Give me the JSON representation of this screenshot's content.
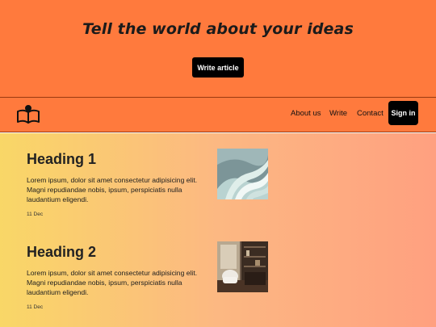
{
  "hero": {
    "title": "Tell the world about your ideas",
    "write_button": "Write article"
  },
  "nav": {
    "logo_icon": "open-book-icon",
    "links": [
      "About us",
      "Write",
      "Contact"
    ],
    "signin_button": "Sign in"
  },
  "articles": [
    {
      "heading": "Heading 1",
      "body": "Lorem ipsum, dolor sit amet consectetur adipisicing elit. Magni repudiandae nobis, ipsum, perspiciatis nulla laudantium eligendi.",
      "date": "11 Dec",
      "image": "abstract-waves-image"
    },
    {
      "heading": "Heading 2",
      "body": "Lorem ipsum, dolor sit amet consectetur adipisicing elit. Magni repudiandae nobis, ipsum, perspiciatis nulla laudantium eligendi.",
      "date": "11 Dec",
      "image": "interior-room-image"
    }
  ],
  "colors": {
    "header_bg": "#ff7a3d",
    "button_bg": "#000000",
    "gradient_start": "#f9d767",
    "gradient_end": "#ffa080"
  }
}
